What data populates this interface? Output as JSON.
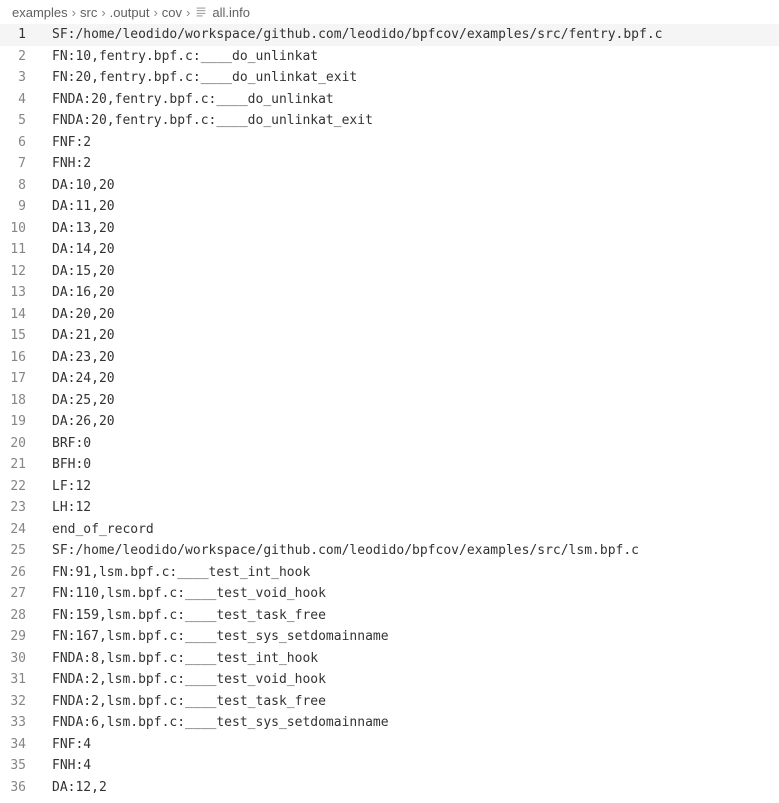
{
  "breadcrumb": {
    "items": [
      "examples",
      "src",
      ".output",
      "cov",
      "all.info"
    ],
    "separator": "›"
  },
  "editor": {
    "current_line": 1,
    "lines": [
      {
        "num": 1,
        "text": "SF:/home/leodido/workspace/github.com/leodido/bpfcov/examples/src/fentry.bpf.c",
        "highlighted": true
      },
      {
        "num": 2,
        "text": "FN:10,fentry.bpf.c:____do_unlinkat"
      },
      {
        "num": 3,
        "text": "FN:20,fentry.bpf.c:____do_unlinkat_exit"
      },
      {
        "num": 4,
        "text": "FNDA:20,fentry.bpf.c:____do_unlinkat"
      },
      {
        "num": 5,
        "text": "FNDA:20,fentry.bpf.c:____do_unlinkat_exit"
      },
      {
        "num": 6,
        "text": "FNF:2"
      },
      {
        "num": 7,
        "text": "FNH:2"
      },
      {
        "num": 8,
        "text": "DA:10,20"
      },
      {
        "num": 9,
        "text": "DA:11,20"
      },
      {
        "num": 10,
        "text": "DA:13,20"
      },
      {
        "num": 11,
        "text": "DA:14,20"
      },
      {
        "num": 12,
        "text": "DA:15,20"
      },
      {
        "num": 13,
        "text": "DA:16,20"
      },
      {
        "num": 14,
        "text": "DA:20,20"
      },
      {
        "num": 15,
        "text": "DA:21,20"
      },
      {
        "num": 16,
        "text": "DA:23,20"
      },
      {
        "num": 17,
        "text": "DA:24,20"
      },
      {
        "num": 18,
        "text": "DA:25,20"
      },
      {
        "num": 19,
        "text": "DA:26,20"
      },
      {
        "num": 20,
        "text": "BRF:0"
      },
      {
        "num": 21,
        "text": "BFH:0"
      },
      {
        "num": 22,
        "text": "LF:12"
      },
      {
        "num": 23,
        "text": "LH:12"
      },
      {
        "num": 24,
        "text": "end_of_record"
      },
      {
        "num": 25,
        "text": "SF:/home/leodido/workspace/github.com/leodido/bpfcov/examples/src/lsm.bpf.c"
      },
      {
        "num": 26,
        "text": "FN:91,lsm.bpf.c:____test_int_hook"
      },
      {
        "num": 27,
        "text": "FN:110,lsm.bpf.c:____test_void_hook"
      },
      {
        "num": 28,
        "text": "FN:159,lsm.bpf.c:____test_task_free"
      },
      {
        "num": 29,
        "text": "FN:167,lsm.bpf.c:____test_sys_setdomainname"
      },
      {
        "num": 30,
        "text": "FNDA:8,lsm.bpf.c:____test_int_hook"
      },
      {
        "num": 31,
        "text": "FNDA:2,lsm.bpf.c:____test_void_hook"
      },
      {
        "num": 32,
        "text": "FNDA:2,lsm.bpf.c:____test_task_free"
      },
      {
        "num": 33,
        "text": "FNDA:6,lsm.bpf.c:____test_sys_setdomainname"
      },
      {
        "num": 34,
        "text": "FNF:4"
      },
      {
        "num": 35,
        "text": "FNH:4"
      },
      {
        "num": 36,
        "text": "DA:12,2"
      }
    ]
  }
}
